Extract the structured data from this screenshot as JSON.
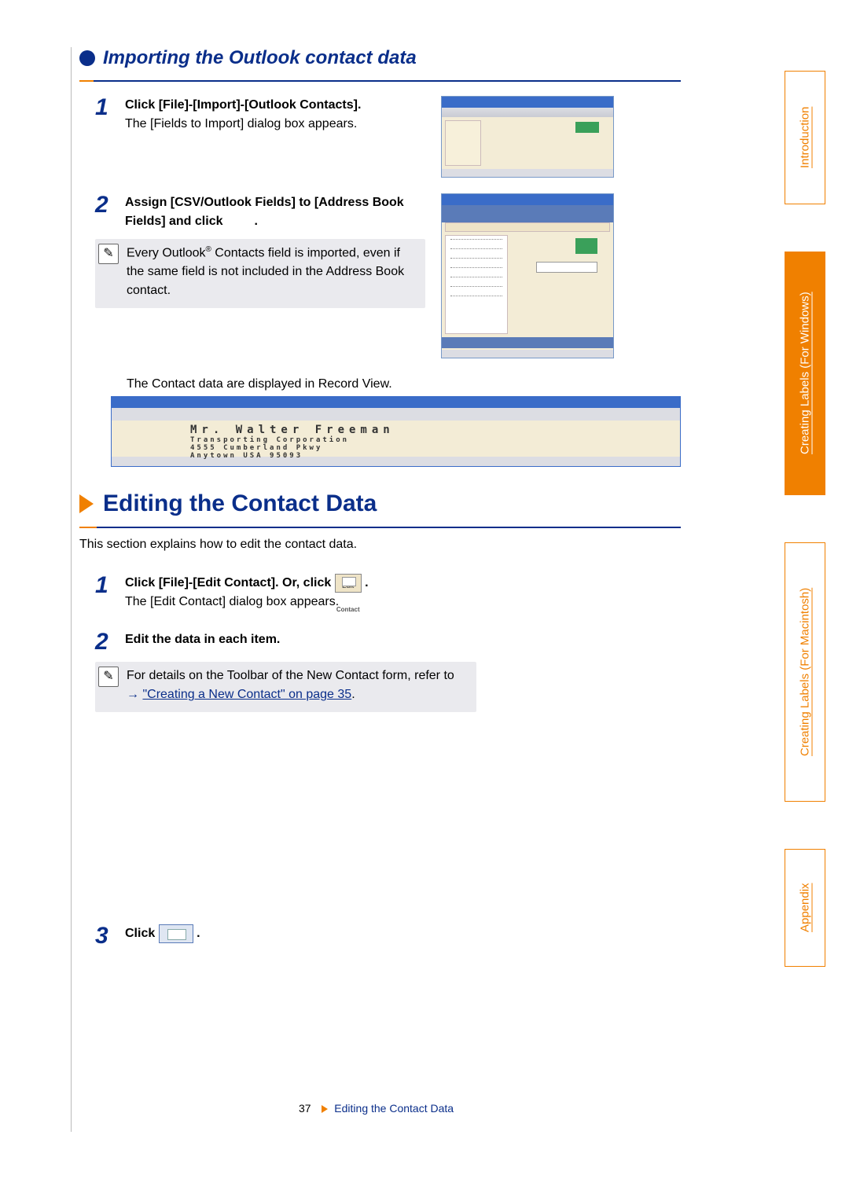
{
  "sub_heading": "Importing the Outlook contact data",
  "import_steps": {
    "s1": {
      "num": "1",
      "title": "Click [File]-[Import]-[Outlook Contacts].",
      "desc": "The [Fields to Import] dialog box appears."
    },
    "s2": {
      "num": "2",
      "title_a": "Assign [CSV/Outlook Fields] to [Address Book Fields] and click",
      "title_b": ".",
      "note_a": "Every Outlook",
      "note_sup": "®",
      "note_b": " Contacts field is imported, even if the same field is not included in the Address Book contact."
    },
    "record_caption": "The Contact data are displayed in Record View.",
    "record_sample_name": "Mr. Walter Freeman",
    "record_sample_line2": "Transporting Corporation",
    "record_sample_line3": "4555 Cumberland Pkwy",
    "record_sample_line4": "Anytown   USA  95093"
  },
  "section2": {
    "title": "Editing the Contact Data",
    "desc": "This section explains how to edit the contact data."
  },
  "edit_steps": {
    "s1": {
      "num": "1",
      "title_a": "Click [File]-[Edit Contact]. Or, click ",
      "title_b": ".",
      "desc": "The [Edit Contact] dialog box appears."
    },
    "s2": {
      "num": "2",
      "title": "Edit the data in each item.",
      "note_a": "For details on the Toolbar of the New Contact form, refer to ",
      "note_link": "\"Creating a New Contact\" on page 35",
      "note_b": "."
    },
    "s3": {
      "num": "3",
      "title_a": "Click ",
      "title_b": "."
    }
  },
  "footer": {
    "page": "37",
    "running_head": "Editing the Contact Data"
  },
  "tabs": {
    "intro": "Introduction",
    "win": "Creating Labels (For Windows)",
    "mac": "Creating Labels (For Macintosh)",
    "app": "Appendix"
  }
}
